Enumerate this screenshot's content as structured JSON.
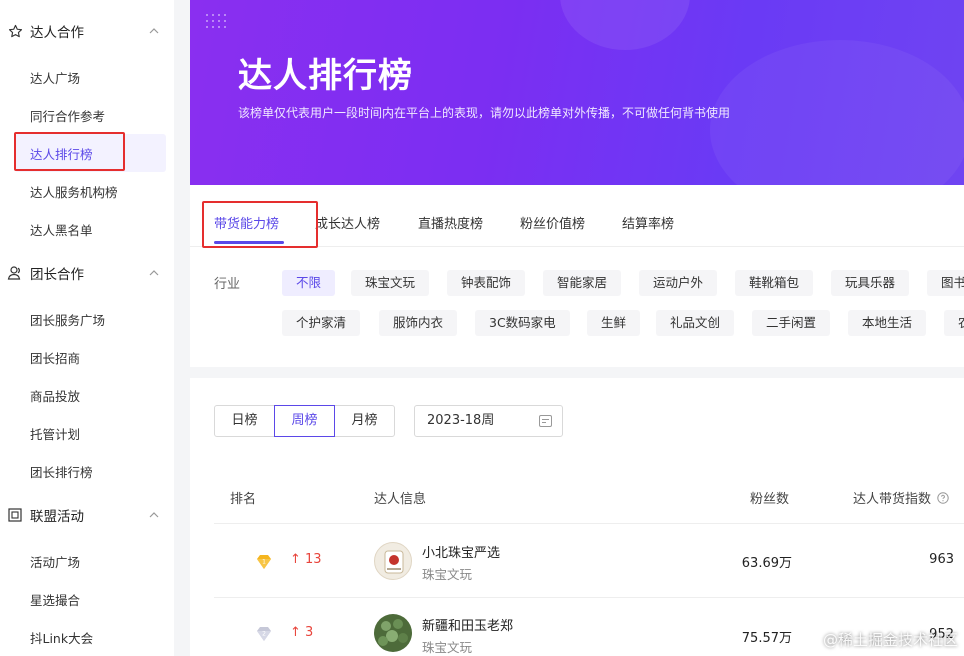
{
  "sidebar": {
    "sections": [
      {
        "title": "达人合作",
        "icon": "star-outline-icon",
        "items": [
          "达人广场",
          "同行合作参考",
          "达人排行榜",
          "达人服务机构榜",
          "达人黑名单"
        ]
      },
      {
        "title": "团长合作",
        "icon": "user-group-icon",
        "items": [
          "团长服务广场",
          "团长招商",
          "商品投放",
          "托管计划",
          "团长排行榜"
        ]
      },
      {
        "title": "联盟活动",
        "icon": "calendar-icon",
        "items": [
          "活动广场",
          "星选撮合",
          "抖Link大会"
        ]
      }
    ],
    "active_item": "达人排行榜"
  },
  "banner": {
    "title": "达人排行榜",
    "subtitle": "该榜单仅代表用户一段时间内在平台上的表现，请勿以此榜单对外传播，不可做任何背书使用"
  },
  "tabs": [
    "带货能力榜",
    "成长达人榜",
    "直播热度榜",
    "粉丝价值榜",
    "结算率榜"
  ],
  "active_tab": "带货能力榜",
  "industry": {
    "label": "行业",
    "row1": [
      "不限",
      "珠宝文玩",
      "钟表配饰",
      "智能家居",
      "运动户外",
      "鞋靴箱包",
      "玩具乐器",
      "图书"
    ],
    "row2": [
      "个护家清",
      "服饰内衣",
      "3C数码家电",
      "生鲜",
      "礼品文创",
      "二手闲置",
      "本地生活",
      "农"
    ],
    "active": "不限"
  },
  "period": {
    "options": [
      "日榜",
      "周榜",
      "月榜"
    ],
    "active": "周榜",
    "week": "2023-18周"
  },
  "table": {
    "headers": {
      "rank": "排名",
      "info": "达人信息",
      "fans": "粉丝数",
      "index": "达人带货指数"
    },
    "rows": [
      {
        "rank": 1,
        "medal_color": "#f5b51e",
        "change": "13",
        "name": "小北珠宝严选",
        "category": "珠宝文玩",
        "fans": "63.69万",
        "score": "963"
      },
      {
        "rank": 2,
        "medal_color": "#c6c8d8",
        "change": "3",
        "name": "新疆和田玉老郑",
        "category": "珠宝文玩",
        "fans": "75.57万",
        "score": "952"
      }
    ]
  },
  "watermark": "@稀土掘金技术社区",
  "colors": {
    "accent": "#5b48e8",
    "banner": "#7b2ef2",
    "rise": "#e8453c",
    "highlight": "#e52e2e"
  }
}
